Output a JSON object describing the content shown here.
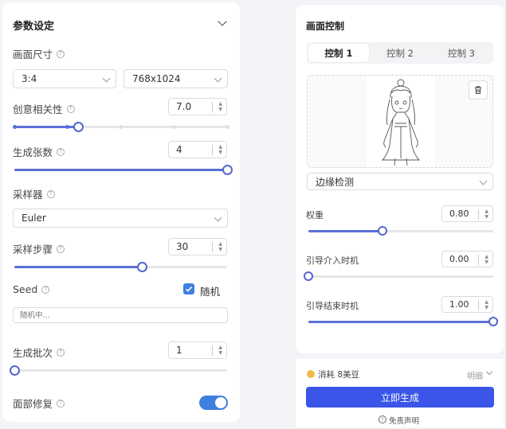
{
  "params": {
    "title": "参数设定",
    "canvas_size": {
      "label": "画面尺寸",
      "ratio": "3:4",
      "resolution": "768x1024"
    },
    "creativity": {
      "label": "创意相关性",
      "value": "7.0",
      "level": 0.3
    },
    "count": {
      "label": "生成张数",
      "value": "4",
      "level": 1.0
    },
    "sampler": {
      "label": "采样器",
      "value": "Euler"
    },
    "steps": {
      "label": "采样步骤",
      "value": "30",
      "level": 0.6
    },
    "seed": {
      "label": "Seed",
      "random_label": "随机",
      "placeholder": "随机中..."
    },
    "batch": {
      "label": "生成批次",
      "value": "1",
      "level": 0.0
    },
    "face_fix": {
      "label": "面部修复",
      "enabled": true
    }
  },
  "control": {
    "title": "画面控制",
    "tabs": [
      "控制 1",
      "控制 2",
      "控制 3"
    ],
    "active_tab": 0,
    "preprocessor": "边缘检测",
    "weight": {
      "label": "权重",
      "value": "0.80",
      "level": 0.4
    },
    "start": {
      "label": "引导介入时机",
      "value": "0.00",
      "level": 0.0
    },
    "end": {
      "label": "引导结束时机",
      "value": "1.00",
      "level": 1.0
    }
  },
  "footer": {
    "cost": "消耗 8美豆",
    "detail": "明细",
    "generate": "立即生成",
    "disclaimer": "免责声明"
  },
  "colors": {
    "accent": "#3a55e8",
    "slider": "#5b6fd6",
    "toggle": "#3f7fe0"
  }
}
